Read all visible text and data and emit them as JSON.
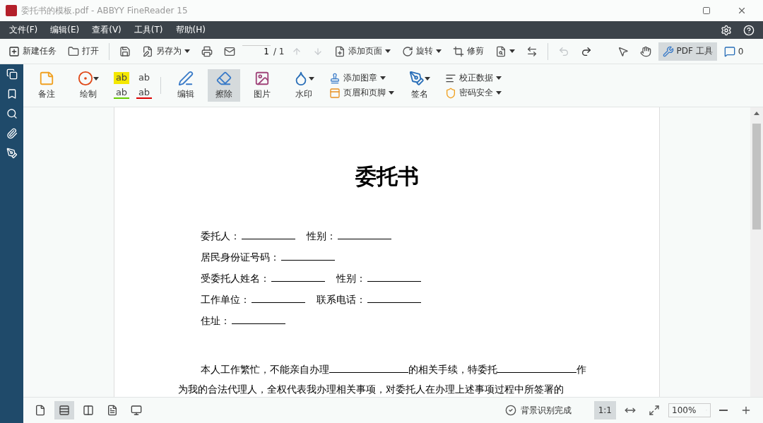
{
  "window": {
    "title": "委托书的模板.pdf - ABBYY FineReader 15"
  },
  "menu": [
    "文件(F)",
    "编辑(E)",
    "查看(V)",
    "工具(T)",
    "帮助(H)"
  ],
  "toolbar": {
    "new_task": "新建任务",
    "open": "打开",
    "save_as": "另存为",
    "page_field": "1",
    "page_total": "/ 1",
    "add_page": "添加页面",
    "rotate": "旋转",
    "crop": "修剪",
    "undo_disabled": true,
    "pdf_tools": {
      "label": "PDF 工具",
      "selected": true
    },
    "comments": "0"
  },
  "ribbon": [
    {
      "kind": "big",
      "label": "备注",
      "selected": false,
      "dropdown": false
    },
    {
      "kind": "big",
      "label": "绘制",
      "selected": false,
      "dropdown": true
    },
    {
      "kind": "marks",
      "items": [
        "ab",
        "ab",
        "ab",
        "ab"
      ]
    },
    {
      "kind": "sep"
    },
    {
      "kind": "big",
      "label": "编辑",
      "selected": false,
      "dropdown": false
    },
    {
      "kind": "big",
      "label": "擦除",
      "selected": true,
      "dropdown": false
    },
    {
      "kind": "big",
      "label": "图片",
      "selected": false,
      "dropdown": false
    },
    {
      "kind": "big",
      "label": "水印",
      "selected": false,
      "dropdown": true
    },
    {
      "kind": "pair",
      "items": [
        {
          "label": "添加图章"
        },
        {
          "label": "页眉和页脚"
        }
      ]
    },
    {
      "kind": "big",
      "label": "签名",
      "selected": false,
      "dropdown": true
    },
    {
      "kind": "pair",
      "items": [
        {
          "label": "校正数据"
        },
        {
          "label": "密码安全"
        }
      ]
    }
  ],
  "document": {
    "title": "委托书",
    "form_rows": [
      [
        "委托人：",
        "性别："
      ],
      [
        "居民身份证号码："
      ],
      [
        "受委托人姓名：",
        "性别："
      ],
      [
        "工作单位：",
        "联系电话："
      ],
      [
        "住址："
      ]
    ],
    "paragraph": [
      "本人工作繁忙，不能亲自办理",
      "的相关手续，特委托",
      "作为我的合法代理人，全权代表我办理相关事项，对委托人在办理上述事项过程中所签署的"
    ]
  },
  "status_bar": {
    "views": [
      {
        "selected": false
      },
      {
        "selected": true
      },
      {
        "selected": false
      },
      {
        "selected": false
      },
      {
        "selected": false
      }
    ],
    "status": "背景识别完成",
    "actual_size": {
      "label": "1:1",
      "selected": true
    },
    "zoom": "100%"
  }
}
